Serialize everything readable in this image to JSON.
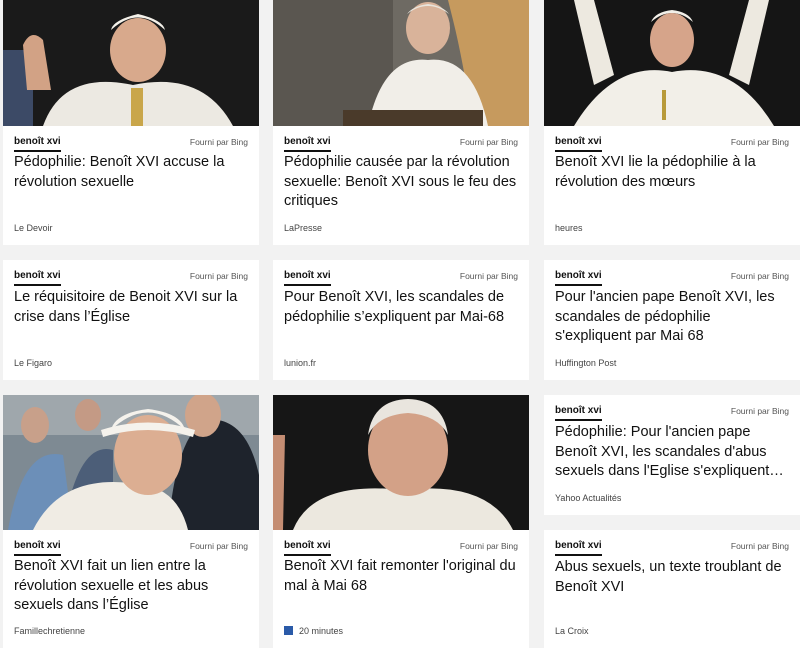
{
  "cards": [
    {
      "tag": "benoît xvi",
      "provider": "Fourni par Bing",
      "headline": "Pédophilie: Benoît XVI accuse la révolution sexuelle",
      "source": "Le Devoir"
    },
    {
      "tag": "benoît xvi",
      "provider": "Fourni par Bing",
      "headline": "Pédophilie causée par la révolution sexuelle: Benoît XVI sous le feu des critiques",
      "source": "LaPresse"
    },
    {
      "tag": "benoît xvi",
      "provider": "Fourni par Bing",
      "headline": "Benoît XVI lie la pédophilie à la révolution des mœurs",
      "source": "heures"
    },
    {
      "tag": "benoît xvi",
      "provider": "Fourni par Bing",
      "headline": "Le réquisitoire de Benoit XVI sur la crise dans l’Église",
      "source": "Le Figaro"
    },
    {
      "tag": "benoît xvi",
      "provider": "Fourni par Bing",
      "headline": "Pour Benoît XVI, les scandales de pédophilie s’expliquent par Mai-68",
      "source": "lunion.fr"
    },
    {
      "tag": "benoît xvi",
      "provider": "Fourni par Bing",
      "headline": "Pour l'ancien pape Benoît XVI, les scandales de pédophilie s'expliquent par Mai 68",
      "source": "Huffington Post"
    },
    {
      "tag": "benoît xvi",
      "provider": "Fourni par Bing",
      "headline": "Benoît XVI fait un lien entre la révolution sexuelle et les abus sexuels dans l’Église",
      "source": "Famillechretienne"
    },
    {
      "tag": "benoît xvi",
      "provider": "Fourni par Bing",
      "headline": "Benoît XVI fait remonter l'original du mal à Mai 68",
      "source": "20 minutes"
    },
    {
      "tag": "benoît xvi",
      "provider": "Fourni par Bing",
      "headline": "Pédophilie: Pour l'ancien pape Benoît XVI, les scandales d'abus sexuels dans l'Eglise s'expliquent…",
      "source": "Yahoo Actualités"
    },
    {
      "tag": "benoît xvi",
      "provider": "Fourni par Bing",
      "headline": "Abus sexuels, un texte troublant de Benoît XVI",
      "source": "La Croix"
    }
  ]
}
